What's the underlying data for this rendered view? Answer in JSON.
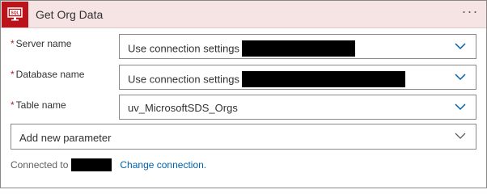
{
  "header": {
    "title": "Get Org Data",
    "app_icon": "sql-server-icon",
    "more_label": "···"
  },
  "fields": [
    {
      "label": "Server name",
      "required_mark": "*",
      "value": "Use connection settings"
    },
    {
      "label": "Database name",
      "required_mark": "*",
      "value": "Use connection settings"
    },
    {
      "label": "Table name",
      "required_mark": "*",
      "value": "uv_MicrosoftSDS_Orgs"
    }
  ],
  "add_param": {
    "label": "Add new parameter"
  },
  "footer": {
    "connected_label": "Connected to",
    "change_link": "Change connection."
  },
  "colors": {
    "accent": "#ba141a",
    "header_bg": "#f6e3e4",
    "link": "#0062ad",
    "chevron": "#0062ad"
  }
}
